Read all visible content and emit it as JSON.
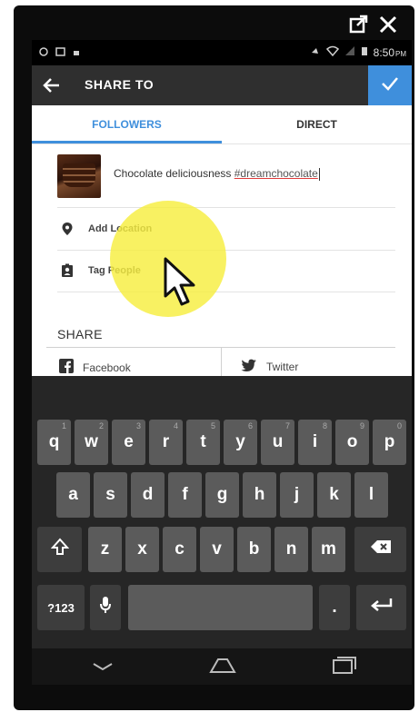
{
  "window": {
    "close_icon": "close-icon",
    "popout_icon": "popout-icon"
  },
  "status_bar": {
    "time": "8:50",
    "ampm": "PM"
  },
  "app_bar": {
    "title": "SHARE TO"
  },
  "tabs": [
    {
      "label": "FOLLOWERS",
      "active": true
    },
    {
      "label": "DIRECT",
      "active": false
    }
  ],
  "post": {
    "caption_text": "Chocolate deliciousness ",
    "caption_tag": "#dreamchocolate"
  },
  "options": [
    {
      "label": "Add Location",
      "icon": "location-pin-icon"
    },
    {
      "label": "Tag People",
      "icon": "tag-people-icon"
    }
  ],
  "share": {
    "heading": "SHARE",
    "targets": [
      {
        "label": "Facebook",
        "icon": "facebook-icon"
      },
      {
        "label": "Twitter",
        "icon": "twitter-icon"
      }
    ]
  },
  "keyboard": {
    "row1": [
      {
        "k": "q",
        "n": "1"
      },
      {
        "k": "w",
        "n": "2"
      },
      {
        "k": "e",
        "n": "3"
      },
      {
        "k": "r",
        "n": "4"
      },
      {
        "k": "t",
        "n": "5"
      },
      {
        "k": "y",
        "n": "6"
      },
      {
        "k": "u",
        "n": "7"
      },
      {
        "k": "i",
        "n": "8"
      },
      {
        "k": "o",
        "n": "9"
      },
      {
        "k": "p",
        "n": "0"
      }
    ],
    "row2": [
      "a",
      "s",
      "d",
      "f",
      "g",
      "h",
      "j",
      "k",
      "l"
    ],
    "row3": [
      "z",
      "x",
      "c",
      "v",
      "b",
      "n",
      "m"
    ],
    "symbols_label": "?123",
    "period_label": "."
  }
}
